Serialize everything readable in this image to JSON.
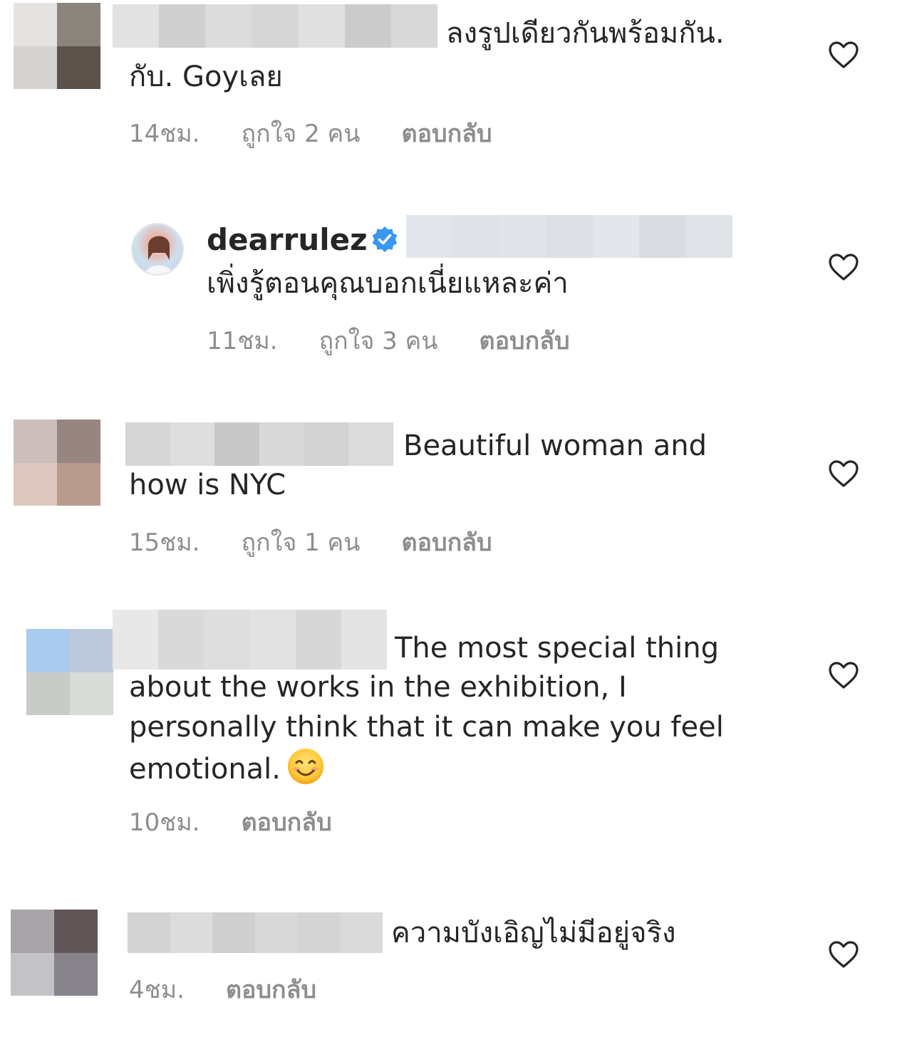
{
  "comments": [
    {
      "text_line1": "ลงรูปเดียวกันพร้อมกัน.",
      "text_line2": "กับ. Goyเลย",
      "time": "14ชม.",
      "likes": "ถูกใจ 2 คน",
      "reply": "ตอบกลับ",
      "heart_icon": "heart-outline-icon"
    },
    {
      "username": "dearrulez",
      "verified_icon": "verified-badge-icon",
      "text": "เพิ่งรู้ตอนคุณบอกเนี่ยแหละค่า",
      "time": "11ชม.",
      "likes": "ถูกใจ 3 คน",
      "reply": "ตอบกลับ",
      "heart_icon": "heart-outline-icon"
    },
    {
      "text_line1": "Beautiful woman and",
      "text_line2": "how is NYC",
      "time": "15ชม.",
      "likes": "ถูกใจ 1 คน",
      "reply": "ตอบกลับ",
      "heart_icon": "heart-outline-icon"
    },
    {
      "text_line1": "The most special thing",
      "text_rest": "about the works in the exhibition, I personally think that it can make you feel emotional.",
      "emoji": "smiling-face-emoji",
      "time": "10ชม.",
      "reply": "ตอบกลับ",
      "heart_icon": "heart-outline-icon"
    },
    {
      "text": "ความบังเอิญไม่มีอยู่จริง",
      "time": "4ชม.",
      "reply": "ตอบกลับ",
      "heart_icon": "heart-outline-icon"
    }
  ],
  "colors": {
    "text": "#262626",
    "meta": "#8e8e8e",
    "verified": "#3897f0"
  }
}
